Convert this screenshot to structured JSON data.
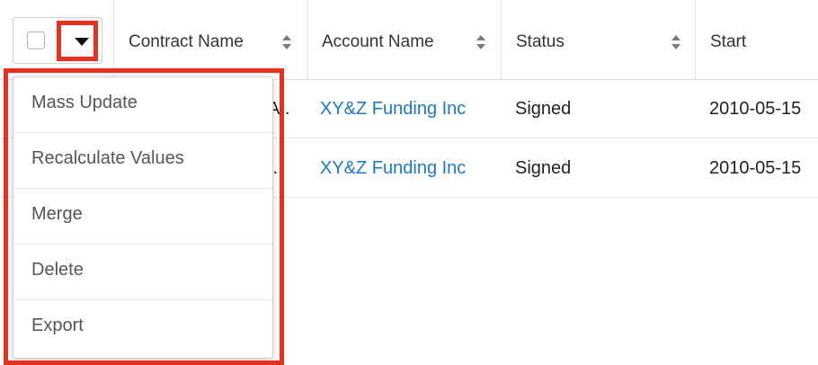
{
  "table": {
    "columns": [
      {
        "label": "Contract Name"
      },
      {
        "label": "Account Name"
      },
      {
        "label": "Status"
      },
      {
        "label": "Start"
      }
    ],
    "rows": [
      {
        "contract_name": "A..",
        "account_name": "XY&Z Funding Inc",
        "status": "Signed",
        "start": "2010-05-15"
      },
      {
        "contract_name": "..",
        "account_name": "XY&Z Funding Inc",
        "status": "Signed",
        "start": "2010-05-15"
      }
    ]
  },
  "actions_menu": {
    "items": [
      "Mass Update",
      "Recalculate Values",
      "Merge",
      "Delete",
      "Export"
    ]
  },
  "colors": {
    "highlight": "#e8301f",
    "link": "#1a79c9"
  }
}
